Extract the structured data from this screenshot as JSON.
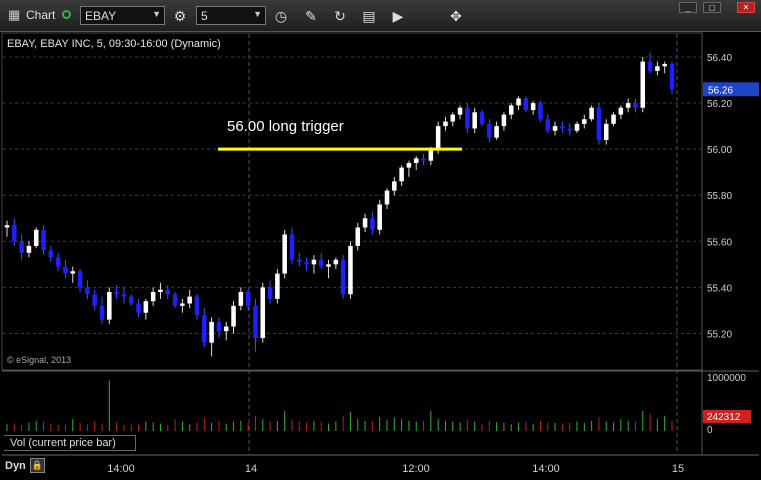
{
  "toolbar": {
    "app_title": "Chart",
    "symbol_value": "EBAY",
    "interval_value": "5",
    "icons": [
      "app-icon",
      "link-status-icon",
      "settings-gear-icon",
      "clock-icon",
      "pencil-icon",
      "refresh-icon",
      "study-icon",
      "play-icon",
      "cursor-icon"
    ]
  },
  "window": {
    "controls": [
      "minimize",
      "maximize",
      "close"
    ]
  },
  "chart_header": "EBAY, EBAY INC, 5, 09:30-16:00 (Dynamic)",
  "copyright": "© eSignal, 2013",
  "annotation": {
    "text": "56.00 long trigger",
    "price": 56.0,
    "color": "#ffff00"
  },
  "price_axis": {
    "ticks": [
      "56.40",
      "56.20",
      "56.00",
      "55.80",
      "55.60",
      "55.40",
      "55.20"
    ],
    "last_price": "56.26",
    "last_price_color": "#1f44c9"
  },
  "volume_axis": {
    "ticks": [
      "1000000",
      "0"
    ],
    "last_volume": "242312",
    "last_volume_color": "#d02020"
  },
  "volume_label": "Vol (current price bar)",
  "time_axis": [
    "14:00",
    "14",
    "12:00",
    "14:00",
    "15"
  ],
  "footer": {
    "mode_label": "Dyn"
  },
  "chart_data": {
    "type": "candlestick",
    "title": "EBAY, EBAY INC, 5, 09:30-16:00 (Dynamic)",
    "ylim": [
      55.05,
      56.5
    ],
    "up_color": "#ffffff",
    "down_color": "#1f1fff",
    "candles": [
      [
        55.66,
        55.69,
        55.62,
        55.67
      ],
      [
        55.67,
        55.7,
        55.58,
        55.6
      ],
      [
        55.6,
        55.63,
        55.52,
        55.55
      ],
      [
        55.55,
        55.6,
        55.53,
        55.58
      ],
      [
        55.58,
        55.66,
        55.57,
        55.65
      ],
      [
        55.65,
        55.67,
        55.54,
        55.56
      ],
      [
        55.56,
        55.58,
        55.51,
        55.53
      ],
      [
        55.53,
        55.55,
        55.47,
        55.49
      ],
      [
        55.49,
        55.52,
        55.44,
        55.46
      ],
      [
        55.46,
        55.49,
        55.42,
        55.47
      ],
      [
        55.47,
        55.48,
        55.38,
        55.4
      ],
      [
        55.4,
        55.43,
        55.35,
        55.37
      ],
      [
        55.37,
        55.39,
        55.3,
        55.32
      ],
      [
        55.32,
        55.36,
        55.24,
        55.26
      ],
      [
        55.26,
        55.4,
        55.24,
        55.38
      ],
      [
        55.38,
        55.41,
        55.35,
        55.37
      ],
      [
        55.37,
        55.4,
        55.33,
        55.36
      ],
      [
        55.36,
        55.37,
        55.32,
        55.33
      ],
      [
        55.33,
        55.35,
        55.27,
        55.29
      ],
      [
        55.29,
        55.35,
        55.26,
        55.34
      ],
      [
        55.34,
        55.4,
        55.32,
        55.38
      ],
      [
        55.38,
        55.42,
        55.35,
        55.39
      ],
      [
        55.39,
        55.41,
        55.35,
        55.37
      ],
      [
        55.37,
        55.38,
        55.31,
        55.32
      ],
      [
        55.32,
        55.35,
        55.29,
        55.33
      ],
      [
        55.33,
        55.39,
        55.31,
        55.36
      ],
      [
        55.36,
        55.37,
        55.26,
        55.28
      ],
      [
        55.28,
        55.31,
        55.14,
        55.16
      ],
      [
        55.16,
        55.27,
        55.1,
        55.25
      ],
      [
        55.25,
        55.27,
        55.18,
        55.21
      ],
      [
        55.21,
        55.25,
        55.17,
        55.23
      ],
      [
        55.23,
        55.34,
        55.2,
        55.32
      ],
      [
        55.32,
        55.4,
        55.3,
        55.38
      ],
      [
        55.38,
        55.39,
        55.3,
        55.32
      ],
      [
        55.32,
        55.35,
        55.12,
        55.18
      ],
      [
        55.18,
        55.42,
        55.16,
        55.4
      ],
      [
        55.4,
        55.43,
        55.33,
        55.35
      ],
      [
        55.35,
        55.48,
        55.33,
        55.46
      ],
      [
        55.46,
        55.65,
        55.44,
        55.63
      ],
      [
        55.63,
        55.66,
        55.5,
        55.52
      ],
      [
        55.52,
        55.55,
        55.49,
        55.51
      ],
      [
        55.51,
        55.53,
        55.47,
        55.5
      ],
      [
        55.5,
        55.54,
        55.46,
        55.52
      ],
      [
        55.52,
        55.55,
        55.48,
        55.49
      ],
      [
        55.49,
        55.52,
        55.44,
        55.5
      ],
      [
        55.5,
        55.53,
        55.48,
        55.52
      ],
      [
        55.52,
        55.54,
        55.35,
        55.37
      ],
      [
        55.37,
        55.6,
        55.35,
        55.58
      ],
      [
        55.58,
        55.68,
        55.56,
        55.66
      ],
      [
        55.66,
        55.72,
        55.64,
        55.7
      ],
      [
        55.7,
        55.73,
        55.63,
        55.65
      ],
      [
        55.65,
        55.78,
        55.63,
        55.76
      ],
      [
        55.76,
        55.83,
        55.74,
        55.82
      ],
      [
        55.82,
        55.88,
        55.8,
        55.86
      ],
      [
        55.86,
        55.93,
        55.84,
        55.92
      ],
      [
        55.92,
        55.95,
        55.88,
        55.94
      ],
      [
        55.94,
        55.97,
        55.91,
        55.96
      ],
      [
        55.96,
        55.98,
        55.93,
        55.95
      ],
      [
        55.95,
        56.01,
        55.93,
        56.0
      ],
      [
        56.0,
        56.12,
        55.98,
        56.1
      ],
      [
        56.1,
        56.14,
        56.08,
        56.12
      ],
      [
        56.12,
        56.16,
        56.1,
        56.15
      ],
      [
        56.15,
        56.19,
        56.13,
        56.18
      ],
      [
        56.18,
        56.2,
        56.07,
        56.09
      ],
      [
        56.09,
        56.18,
        56.07,
        56.16
      ],
      [
        56.16,
        56.17,
        56.1,
        56.11
      ],
      [
        56.11,
        56.13,
        56.03,
        56.05
      ],
      [
        56.05,
        56.12,
        56.04,
        56.1
      ],
      [
        56.1,
        56.16,
        56.08,
        56.15
      ],
      [
        56.15,
        56.2,
        56.13,
        56.19
      ],
      [
        56.19,
        56.23,
        56.17,
        56.22
      ],
      [
        56.22,
        56.23,
        56.16,
        56.17
      ],
      [
        56.17,
        56.21,
        56.15,
        56.2
      ],
      [
        56.2,
        56.21,
        56.12,
        56.13
      ],
      [
        56.13,
        56.15,
        56.07,
        56.08
      ],
      [
        56.08,
        56.12,
        56.06,
        56.1
      ],
      [
        56.1,
        56.12,
        56.07,
        56.09
      ],
      [
        56.09,
        56.11,
        56.06,
        56.08
      ],
      [
        56.08,
        56.12,
        56.07,
        56.11
      ],
      [
        56.11,
        56.15,
        56.09,
        56.13
      ],
      [
        56.13,
        56.19,
        56.12,
        56.18
      ],
      [
        56.18,
        56.2,
        56.02,
        56.04
      ],
      [
        56.04,
        56.13,
        56.02,
        56.11
      ],
      [
        56.11,
        56.16,
        56.1,
        56.15
      ],
      [
        56.15,
        56.19,
        56.13,
        56.18
      ],
      [
        56.18,
        56.22,
        56.16,
        56.2
      ],
      [
        56.2,
        56.22,
        56.16,
        56.18
      ],
      [
        56.18,
        56.4,
        56.16,
        56.38
      ],
      [
        56.38,
        56.42,
        56.33,
        56.34
      ],
      [
        56.34,
        56.38,
        56.32,
        56.36
      ],
      [
        56.36,
        56.38,
        56.33,
        56.37
      ],
      [
        56.37,
        56.38,
        56.24,
        56.26
      ]
    ],
    "volumes": [
      20,
      22,
      18,
      25,
      30,
      28,
      22,
      18,
      20,
      35,
      24,
      20,
      30,
      22,
      150,
      25,
      18,
      22,
      20,
      28,
      25,
      22,
      18,
      35,
      28,
      20,
      24,
      40,
      25,
      30,
      22,
      28,
      30,
      24,
      45,
      35,
      28,
      30,
      60,
      32,
      28,
      25,
      30,
      26,
      22,
      28,
      45,
      55,
      35,
      30,
      28,
      42,
      32,
      40,
      35,
      30,
      28,
      30,
      60,
      35,
      30,
      28,
      25,
      32,
      28,
      22,
      30,
      26,
      24,
      20,
      25,
      28,
      22,
      30,
      26,
      24,
      22,
      25,
      28,
      24,
      30,
      40,
      28,
      25,
      35,
      30,
      28,
      60,
      50,
      35,
      45,
      30
    ]
  }
}
